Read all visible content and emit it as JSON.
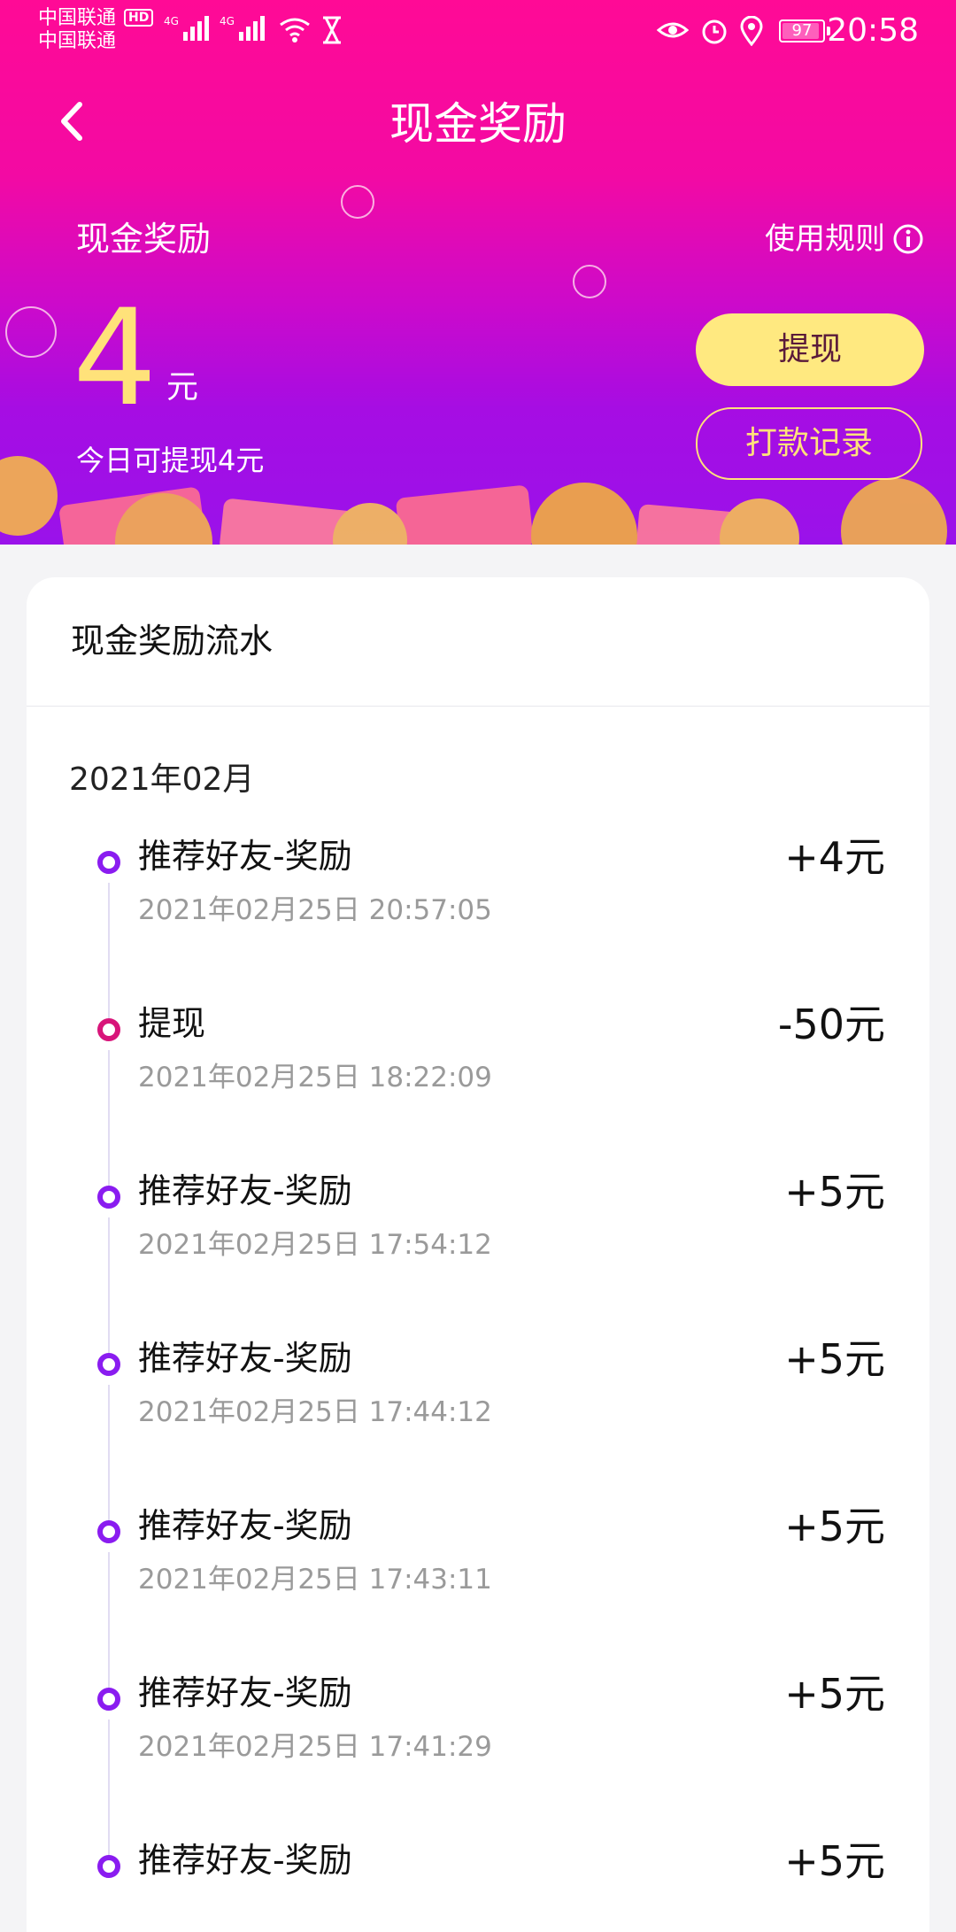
{
  "status_bar": {
    "carrier1": "中国联通",
    "carrier2": "中国联通",
    "hd": "HD",
    "battery": "97",
    "time": "20:58"
  },
  "header": {
    "title": "现金奖励",
    "back_icon": "chevron-left-icon"
  },
  "summary": {
    "label": "现金奖励",
    "rules_label": "使用规则",
    "amount": "4",
    "unit": "元",
    "today_text": "今日可提现4元",
    "withdraw_label": "提现",
    "records_label": "打款记录"
  },
  "flow": {
    "title": "现金奖励流水",
    "month": "2021年02月",
    "items": [
      {
        "title": "推荐好友-奖励",
        "time": "2021年02月25日 20:57:05",
        "amount": "+4元",
        "type": "reward"
      },
      {
        "title": "提现",
        "time": "2021年02月25日 18:22:09",
        "amount": "-50元",
        "type": "withdraw"
      },
      {
        "title": "推荐好友-奖励",
        "time": "2021年02月25日 17:54:12",
        "amount": "+5元",
        "type": "reward"
      },
      {
        "title": "推荐好友-奖励",
        "time": "2021年02月25日 17:44:12",
        "amount": "+5元",
        "type": "reward"
      },
      {
        "title": "推荐好友-奖励",
        "time": "2021年02月25日 17:43:11",
        "amount": "+5元",
        "type": "reward"
      },
      {
        "title": "推荐好友-奖励",
        "time": "2021年02月25日 17:41:29",
        "amount": "+5元",
        "type": "reward"
      },
      {
        "title": "推荐好友-奖励",
        "time": "",
        "amount": "+5元",
        "type": "reward"
      }
    ]
  },
  "colors": {
    "accent_purple": "#8a1cf0",
    "accent_pink": "#d8157a",
    "gold": "#ffe27a"
  }
}
